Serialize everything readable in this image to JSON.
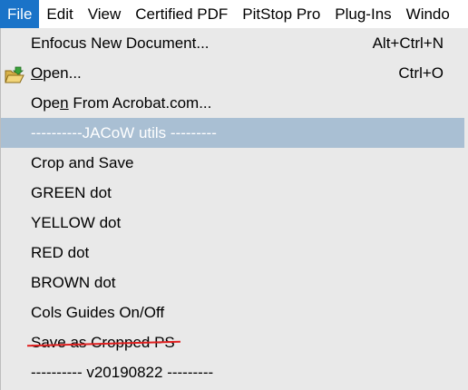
{
  "menubar": {
    "items": [
      {
        "label": "File",
        "active": true
      },
      {
        "label": "Edit"
      },
      {
        "label": "View"
      },
      {
        "label": "Certified PDF"
      },
      {
        "label": "PitStop Pro"
      },
      {
        "label": "Plug-Ins"
      },
      {
        "label": "Windo"
      }
    ]
  },
  "file_menu": {
    "items": [
      {
        "label": "Enfocus New Document...",
        "shortcut": "Alt+Ctrl+N"
      },
      {
        "label_pre": "",
        "label_u": "O",
        "label_post": "pen...",
        "shortcut": "Ctrl+O",
        "icon": "open-folder-icon"
      },
      {
        "label_pre": "Ope",
        "label_u": "n",
        "label_post": " From Acrobat.com..."
      },
      {
        "label": "----------JACoW utils ---------",
        "highlighted": true
      },
      {
        "label": "Crop and Save"
      },
      {
        "label": "GREEN dot"
      },
      {
        "label": "YELLOW dot"
      },
      {
        "label": "RED dot"
      },
      {
        "label": "BROWN dot"
      },
      {
        "label": "Cols Guides On/Off"
      },
      {
        "label": "Save as Cropped PS",
        "struck_out": true
      },
      {
        "label": "---------- v20190822 ---------"
      }
    ]
  },
  "colors": {
    "menubar_active_bg": "#1a73c8",
    "menu_bg": "#e9e9e9",
    "highlight_bg": "#a9bfd3",
    "strike_color": "#e02020"
  }
}
